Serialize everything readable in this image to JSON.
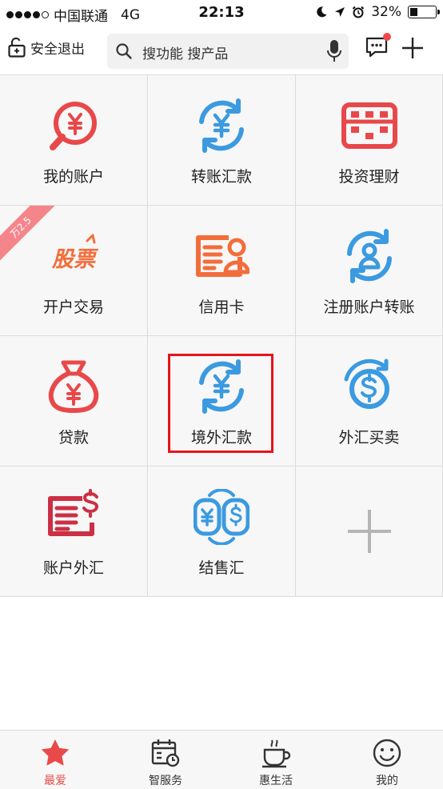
{
  "status_bar": {
    "carrier": "中国联通",
    "network": "4G",
    "time": "22:13",
    "battery_percent": "32%",
    "battery_level": 0.32
  },
  "header": {
    "logout_label": "安全退出",
    "search_placeholder": "搜功能 搜产品"
  },
  "colors": {
    "red": "#e8484a",
    "blue": "#3b9ae0",
    "orange": "#f36d3b",
    "highlight": "#e8131a",
    "tab_active": "#e84a4a"
  },
  "grid": [
    {
      "label": "我的账户",
      "icon": "account-yuan-magnifier-icon"
    },
    {
      "label": "转账汇款",
      "icon": "transfer-yuan-cycle-icon"
    },
    {
      "label": "投资理财",
      "icon": "abacus-icon"
    },
    {
      "label": "开户交易",
      "icon": "stock-logo-icon",
      "logo_text": "股票",
      "ribbon": "万2.5"
    },
    {
      "label": "信用卡",
      "icon": "credit-card-icon"
    },
    {
      "label": "注册账户转账",
      "icon": "person-cycle-icon"
    },
    {
      "label": "贷款",
      "icon": "money-bag-icon"
    },
    {
      "label": "境外汇款",
      "icon": "overseas-yuan-cycle-icon"
    },
    {
      "label": "外汇买卖",
      "icon": "dollar-cycle-icon"
    },
    {
      "label": "账户外汇",
      "icon": "account-dollar-card-icon"
    },
    {
      "label": "结售汇",
      "icon": "yuan-dollar-exchange-icon"
    },
    {
      "label": "",
      "icon": "add-icon"
    }
  ],
  "tabbar": [
    {
      "label": "最爱",
      "icon": "star-icon",
      "active": true
    },
    {
      "label": "智服务",
      "icon": "calendar-clock-icon",
      "active": false
    },
    {
      "label": "惠生活",
      "icon": "coffee-cup-icon",
      "active": false
    },
    {
      "label": "我的",
      "icon": "smiley-icon",
      "active": false
    }
  ]
}
